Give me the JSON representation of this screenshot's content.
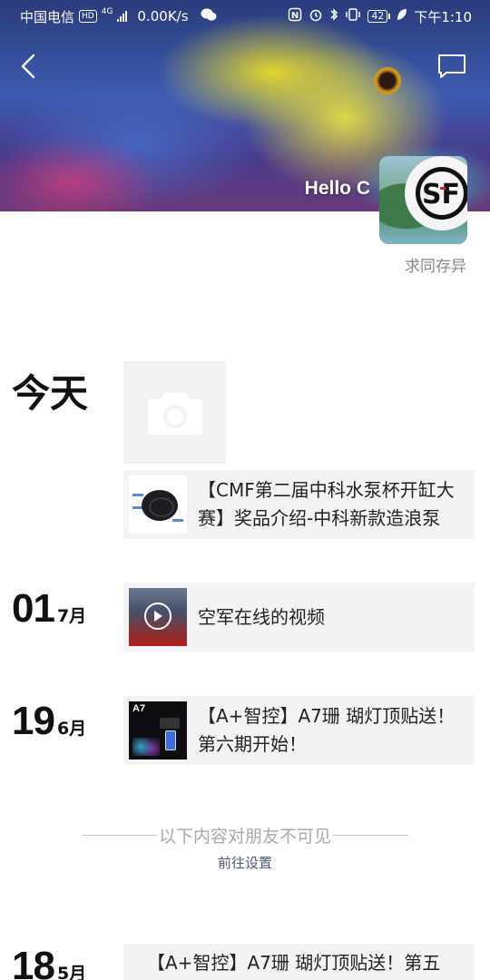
{
  "status_bar": {
    "carrier": "中国电信",
    "hd": "HD",
    "network": "4G",
    "speed": "0.00K/s",
    "battery": "42",
    "time": "下午1:10"
  },
  "header": {
    "user_name": "Hello C",
    "signature": "求同存异"
  },
  "timeline": {
    "today_label": "今天",
    "posts": {
      "pump": "【CMF第二届中科水泵杯开缸大赛】奖品介绍-中科新款造浪泵",
      "video": "空军在线的视频",
      "a7_first": "【A+智控】A7珊 瑚灯顶贴送！第六期开始！",
      "a7_second": "【A+智控】A7珊 瑚灯顶贴送！第五"
    },
    "dates": {
      "d1": {
        "day": "01",
        "month": "7月"
      },
      "d2": {
        "day": "19",
        "month": "6月"
      },
      "d3": {
        "day": "18",
        "month": "5月"
      }
    }
  },
  "privacy": {
    "notice": "以下内容对朋友不可见",
    "link": "前往设置"
  },
  "icons": {
    "back": "chevron-left-icon",
    "comment": "message-icon",
    "camera": "camera-icon",
    "play": "play-icon"
  }
}
